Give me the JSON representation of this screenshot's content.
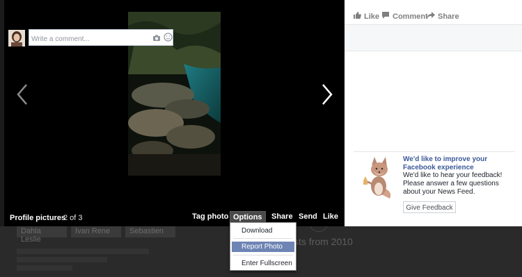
{
  "viewer": {
    "album_title": "Profile pictures",
    "photo_count": "2 of 3",
    "actions": {
      "tag_photo": "Tag photo",
      "options": "Options",
      "share": "Share",
      "send": "Send",
      "like": "Like"
    }
  },
  "options_menu": {
    "items": [
      {
        "label": "Download"
      },
      {
        "label": "Report Photo"
      },
      {
        "label": "Enter Fullscreen"
      }
    ],
    "highlighted_index": 1
  },
  "panel": {
    "like": "Like",
    "comment": "Comment",
    "share": "Share",
    "comment_placeholder": "Write a comment..."
  },
  "feedback": {
    "title": "We'd like to improve your Facebook experience",
    "text": "We'd like to hear your feedback! Please answer a few questions about your News Feed.",
    "button": "Give Feedback"
  },
  "background": {
    "friends": [
      "Dahla Leslie",
      "Ivan Rene",
      "Sebastien"
    ],
    "posts_text": "sts from 2010"
  },
  "colors": {
    "link_blue": "#3b5998",
    "menu_highlight": "#6d84b4"
  }
}
